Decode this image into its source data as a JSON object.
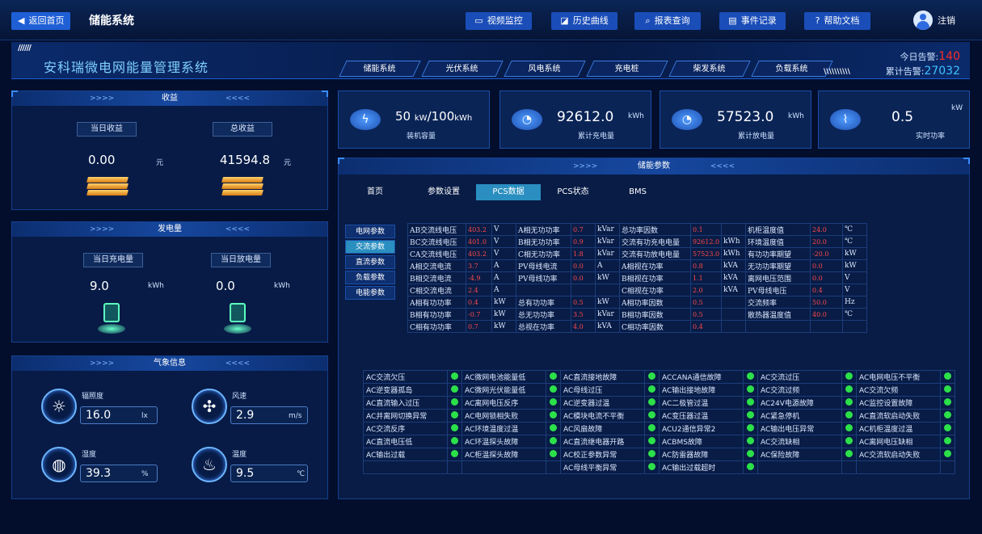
{
  "topbar": {
    "back": "返回首页",
    "title": "储能系统",
    "nav": [
      "视频监控",
      "历史曲线",
      "报表查询",
      "事件记录",
      "帮助文档"
    ],
    "user": "注销"
  },
  "banner": {
    "stripes": "//////",
    "title": "安科瑞微电网能量管理系统",
    "tabs": [
      "储能系统",
      "光伏系统",
      "风电系统",
      "充电桩",
      "柴发系统",
      "负载系统"
    ],
    "stripes_right": "\\\\\\\\\\\\\\\\\\\\",
    "alarm_today_label": "今日告警:",
    "alarm_today": "140",
    "alarm_total_label": "累计告警:",
    "alarm_total": "27032"
  },
  "income": {
    "header": "收益",
    "today_label": "当日收益",
    "total_label": "总收益",
    "today": "0.00",
    "total": "41594.8",
    "unit": "元"
  },
  "energy": {
    "header": "发电量",
    "charge_label": "当日充电量",
    "discharge_label": "当日放电量",
    "charge": "9.0",
    "discharge": "0.0",
    "unit": "kWh"
  },
  "weather": {
    "header": "气象信息",
    "items": [
      {
        "label": "辐照度",
        "value": "16.0",
        "unit": "lx"
      },
      {
        "label": "风速",
        "value": "2.9",
        "unit": "m/s"
      },
      {
        "label": "湿度",
        "value": "39.3",
        "unit": "%"
      },
      {
        "label": "温度",
        "value": "9.5",
        "unit": "℃"
      }
    ]
  },
  "stats": [
    {
      "value": "50",
      "unit": "kW",
      "value2": "/100",
      "unit2": "kWh",
      "label": "装机容量"
    },
    {
      "value": "92612.0",
      "unit": "kWh",
      "label": "累计充电量"
    },
    {
      "value": "57523.0",
      "unit": "kWh",
      "label": "累计放电量"
    },
    {
      "value": "0.5",
      "unit": "kW",
      "label": "实时功率"
    }
  ],
  "pcs": {
    "header": "储能参数",
    "tabs": [
      "首页",
      "参数设置",
      "PCS数据",
      "PCS状态",
      "BMS"
    ],
    "side": [
      "电网参数",
      "交流参数",
      "直流参数",
      "负载参数",
      "电能参数"
    ],
    "rows": [
      [
        "AB交流线电压",
        "403.2",
        "V",
        "A相无功功率",
        "0.7",
        "kVar",
        "总功率因数",
        "0.1",
        "",
        "机柜温度值",
        "24.0",
        "℃"
      ],
      [
        "BC交流线电压",
        "401.0",
        "V",
        "B相无功功率",
        "0.9",
        "kVar",
        "交流有功充电电量",
        "92612.0",
        "kWh",
        "环境温度值",
        "20.0",
        "℃"
      ],
      [
        "CA交流线电压",
        "403.2",
        "V",
        "C相无功功率",
        "1.8",
        "kVar",
        "交流有功放电电量",
        "57523.0",
        "kWh",
        "有功功率期望",
        "-20.0",
        "kW"
      ],
      [
        "A相交流电流",
        "3.7",
        "A",
        "PV母线电流",
        "0.0",
        "A",
        "A相视在功率",
        "0.8",
        "kVA",
        "无功功率期望",
        "0.0",
        "kW"
      ],
      [
        "B相交流电流",
        "-4.9",
        "A",
        "PV母线功率",
        "0.0",
        "kW",
        "B相视在功率",
        "1.1",
        "kVA",
        "离网电压范围",
        "0.0",
        "V"
      ],
      [
        "C相交流电流",
        "2.4",
        "A",
        "",
        "",
        "",
        "C相视在功率",
        "2.0",
        "kVA",
        "PV母线电压",
        "0.4",
        "V"
      ],
      [
        "A相有功功率",
        "0.4",
        "kW",
        "总有功功率",
        "0.5",
        "kW",
        "A相功率因数",
        "0.5",
        "",
        "交流频率",
        "50.0",
        "Hz"
      ],
      [
        "B相有功功率",
        "-0.7",
        "kW",
        "总无功功率",
        "3.5",
        "kVar",
        "B相功率因数",
        "0.5",
        "",
        "散热器温度值",
        "40.0",
        "℃"
      ],
      [
        "C相有功功率",
        "0.7",
        "kW",
        "总视在功率",
        "4.0",
        "kVA",
        "C相功率因数",
        "0.4",
        "",
        "",
        "",
        ""
      ]
    ],
    "alarms": [
      [
        "AC交流欠压",
        "AC微网电池能量低",
        "AC直流接地故障",
        "ACCANA通信故障",
        "AC交流过压",
        "AC电网电压不平衡"
      ],
      [
        "AC逆变器孤岛",
        "AC微网光伏能量低",
        "AC母线过压",
        "AC输出接地故障",
        "AC交流过频",
        "AC交流欠频"
      ],
      [
        "AC直流输入过压",
        "AC离网电压反序",
        "AC逆变器过温",
        "AC二极管过温",
        "AC24V电源故障",
        "AC监控设置故障"
      ],
      [
        "AC并离网切换异常",
        "AC电网锁相失败",
        "AC模块电流不平衡",
        "AC变压器过温",
        "AC紧急停机",
        "AC直流软启动失败"
      ],
      [
        "AC交流反序",
        "AC环境温度过温",
        "AC风扇故障",
        "ACU2通信异常2",
        "AC输出电压异常",
        "AC机柜温度过温"
      ],
      [
        "AC直流电压低",
        "AC环温探头故障",
        "AC直流继电器开路",
        "ACBMS故障",
        "AC交流缺相",
        "AC离网电压缺相"
      ],
      [
        "AC输出过载",
        "AC柜温探头故障",
        "AC校正参数异常",
        "AC防雷器故障",
        "AC保险故障",
        "AC交流软启动失败"
      ],
      [
        "",
        "",
        "AC母线平衡异常",
        "AC输出过载超时",
        "",
        ""
      ]
    ]
  },
  "colors": {
    "accent": "#1f5fd6",
    "alarm_value": "#ff2b2b",
    "total_value": "#3fc1ff",
    "ok_dot": "#2ce04a"
  }
}
